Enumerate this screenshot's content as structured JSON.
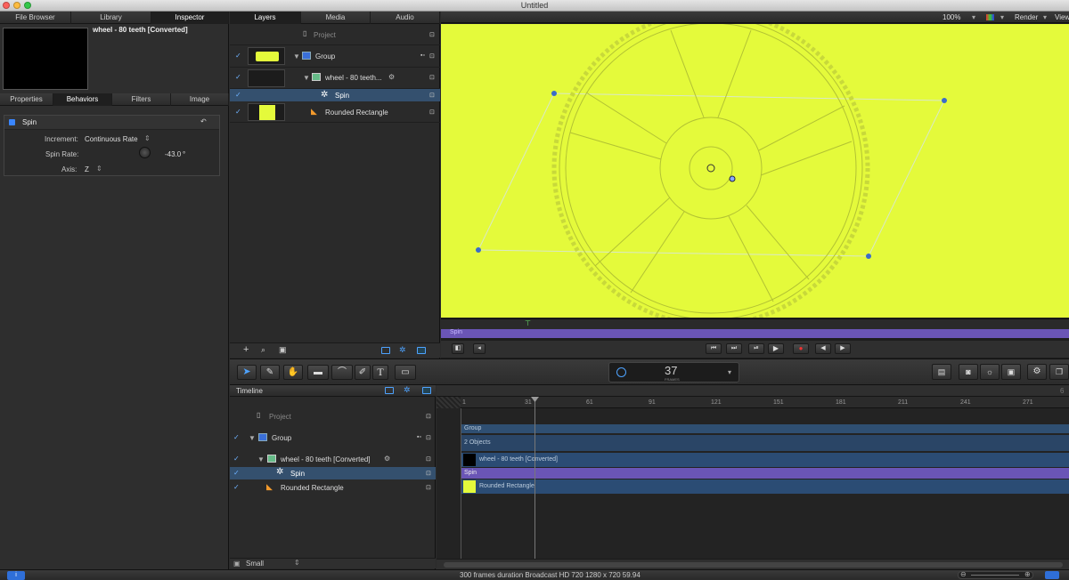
{
  "window": {
    "title": "Untitled"
  },
  "left_panel": {
    "tabs": [
      "File Browser",
      "Library",
      "Inspector"
    ],
    "selected_tab": "Inspector",
    "object_name": "wheel - 80 teeth [Converted]",
    "subtabs": [
      "Properties",
      "Behaviors",
      "Filters",
      "Image"
    ],
    "selected_subtab": "Behaviors",
    "behavior": {
      "name": "Spin",
      "increment_label": "Increment:",
      "increment_value": "Continuous Rate",
      "spin_rate_label": "Spin Rate:",
      "spin_rate_value": "-43.0",
      "spin_rate_unit": "°",
      "axis_label": "Axis:",
      "axis_value": "Z"
    }
  },
  "layers_panel": {
    "tabs": [
      "Layers",
      "Media",
      "Audio"
    ],
    "selected_tab": "Layers",
    "project_label": "Project",
    "layers": [
      {
        "name": "Group",
        "checked": true
      },
      {
        "name": "wheel - 80 teeth...",
        "checked": true
      },
      {
        "name": "Spin",
        "checked": true
      },
      {
        "name": "Rounded Rectangle",
        "checked": true
      }
    ]
  },
  "canvas": {
    "zoom": "100%",
    "render_label": "Render",
    "view_label": "View",
    "background_color": "#e4fa3b",
    "mini_timeline_label": "Spin"
  },
  "toolbar": {
    "frame_number": "37",
    "frame_unit": "FRAMES"
  },
  "timeline": {
    "title": "Timeline",
    "project_label": "Project",
    "layers": [
      {
        "name": "Group",
        "checked": true
      },
      {
        "name": "wheel - 80 teeth [Converted]",
        "checked": true
      },
      {
        "name": "Spin",
        "checked": true
      },
      {
        "name": "Rounded Rectangle",
        "checked": true
      }
    ],
    "ruler_ticks": [
      "1",
      "31",
      "61",
      "91",
      "121",
      "151",
      "181",
      "211",
      "241",
      "271"
    ],
    "tracks": {
      "group_label": "Group",
      "objects_label": "2 Objects",
      "wheel_label": "wheel - 80 teeth [Converted]",
      "spin_label": "Spin",
      "rect_label": "Rounded Rectangle"
    },
    "size_option": "Small"
  },
  "status_bar": {
    "text": "300 frames duration Broadcast HD 720 1280 x 720 59.94"
  }
}
